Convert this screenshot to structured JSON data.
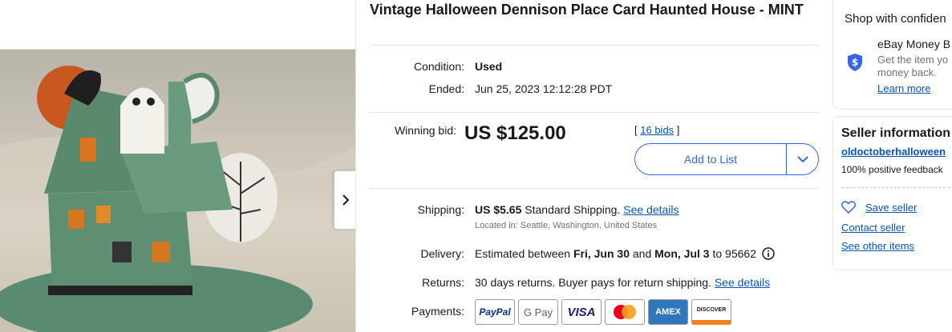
{
  "listing": {
    "title": "Vintage Halloween Dennison Place Card Haunted House - MINT"
  },
  "gallery": {
    "next_icon": "chevron-right-icon"
  },
  "condition": {
    "label": "Condition:",
    "value": "Used"
  },
  "ended": {
    "label": "Ended:",
    "value": "Jun 25, 2023 12:12:28 PDT"
  },
  "bid": {
    "label": "Winning bid:",
    "price": "US $125.00",
    "bids_open": "[",
    "bids_link": "16 bids",
    "bids_close": "]",
    "add_to_list": "Add to List"
  },
  "shipping": {
    "label": "Shipping:",
    "cost": "US $5.65",
    "method": "Standard Shipping.",
    "details_link": "See details",
    "location": "Located in: Seattle, Washington, United States"
  },
  "delivery": {
    "label": "Delivery:",
    "text_1": "Estimated between",
    "date_1": "Fri, Jun 30",
    "and": "and",
    "date_2": "Mon, Jul 3",
    "text_2": "to 95662"
  },
  "returns": {
    "label": "Returns:",
    "text": "30 days returns. Buyer pays for return shipping.",
    "details_link": "See details"
  },
  "payments": {
    "label": "Payments:",
    "methods": [
      "PayPal",
      "G Pay",
      "VISA",
      "Mastercard",
      "AMEX",
      "DISCOVER"
    ]
  },
  "guarantee": {
    "title": "Shop with confiden",
    "heading": "eBay Money B",
    "line1": "Get the item yo",
    "line2": "money back.",
    "learn_more": "Learn more"
  },
  "seller": {
    "title": "Seller information",
    "name": "oldoctoberhalloween",
    "feedback": "100% positive feedback",
    "save": "Save seller",
    "contact": "Contact seller",
    "other_items": "See other items"
  },
  "colors": {
    "link": "#0654ba",
    "accent": "#3665f3",
    "text": "#191919",
    "muted": "#707070"
  }
}
